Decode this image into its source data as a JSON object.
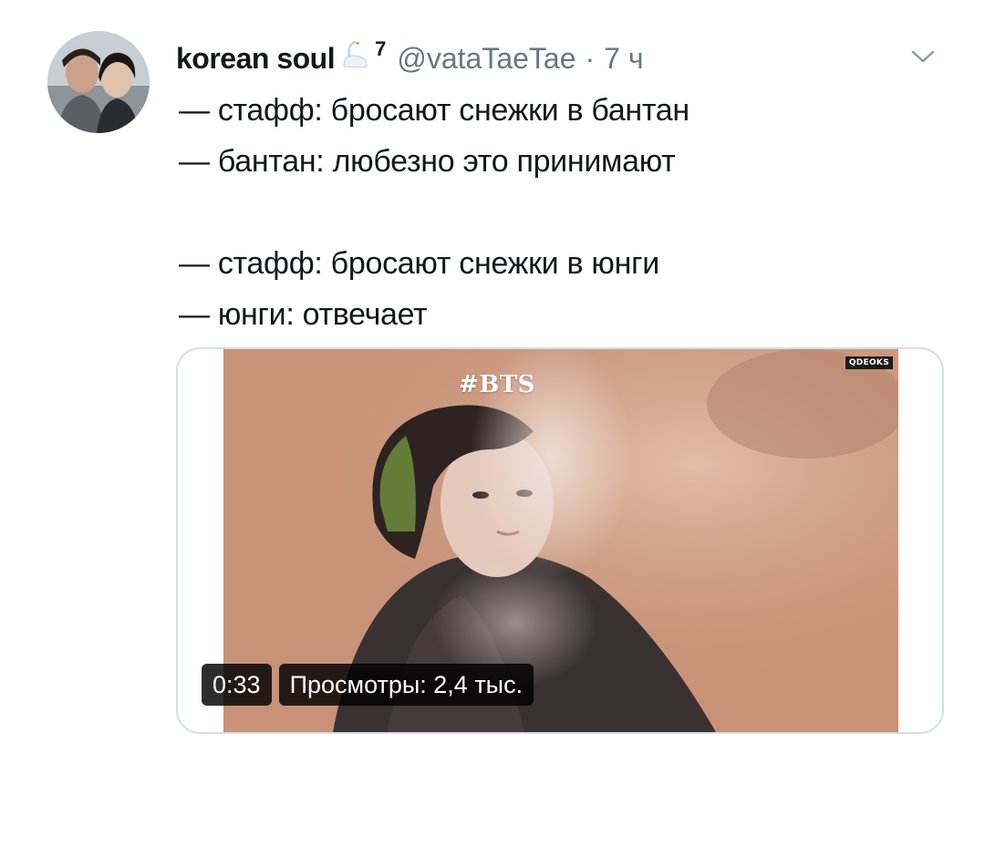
{
  "tweet": {
    "author": {
      "name": "korean soul",
      "badge_icon": "swan-icon",
      "number": "7",
      "handle": "@vataTaeTae",
      "separator": "·",
      "time": "7 ч"
    },
    "menu_icon": "chevron-down-icon",
    "text_lines": [
      "— стафф: бросают снежки в бантан",
      "— бантан: любезно это принимают",
      "",
      "— стафф: бросают снежки в юнги",
      "— юнги: отвечает"
    ],
    "media": {
      "hashtag": "#BTS",
      "watermark": "QDEOKS",
      "duration": "0:33",
      "views": "Просмотры: 2,4 тыс."
    }
  },
  "colors": {
    "text": "#14171a",
    "muted": "#657786",
    "card_border": "#d6dde3",
    "video_bg": "#c99a80"
  }
}
